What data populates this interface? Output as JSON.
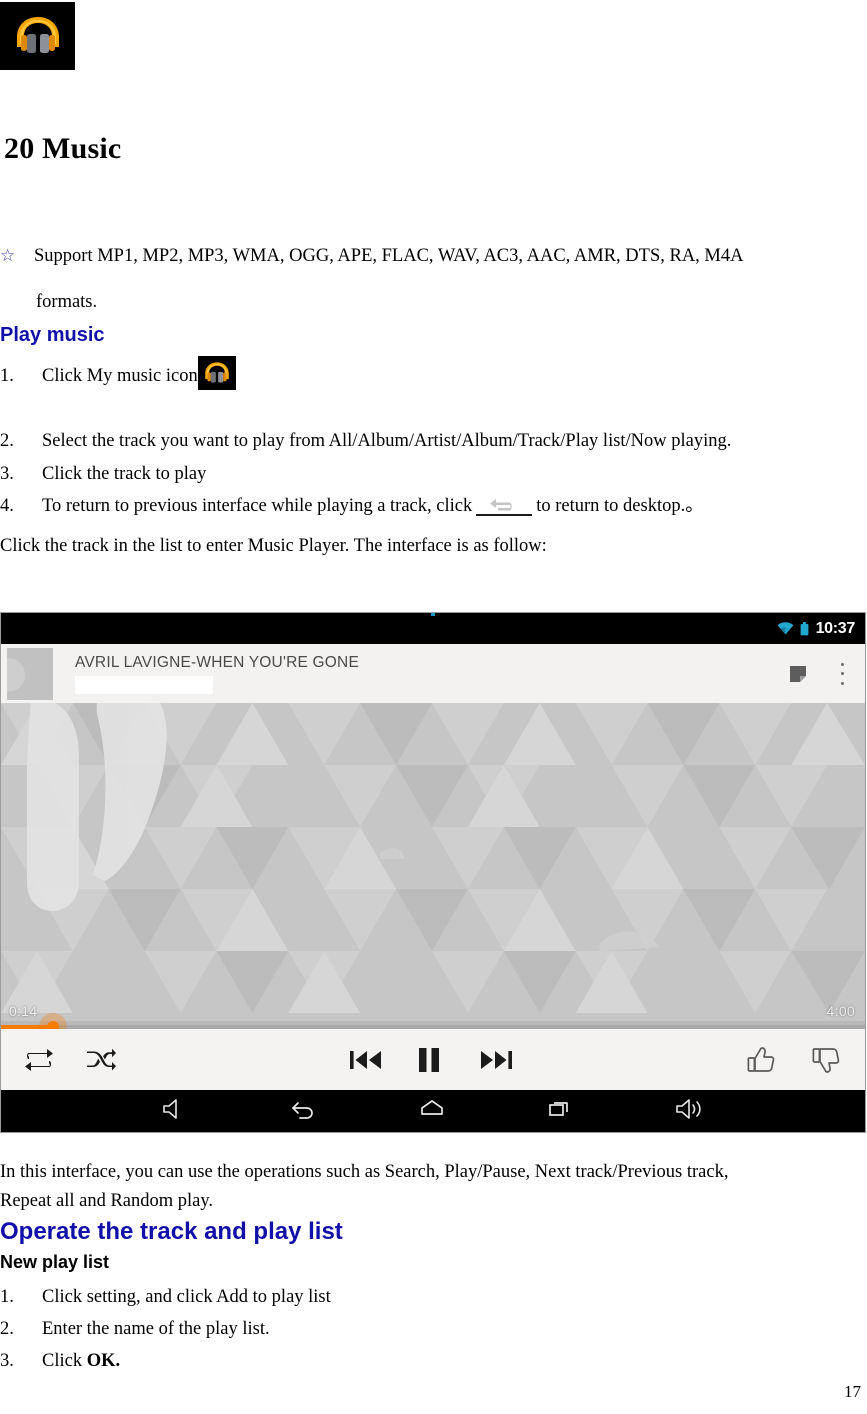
{
  "document": {
    "chapter_title": "20 Music",
    "bullet_star": "☆",
    "bullet_text": "Support MP1, MP2, MP3, WMA, OGG, APE, FLAC, WAV, AC3, AAC, AMR, DTS, RA, M4A",
    "bullet_text_cont": "formats.",
    "heading_play_music": "Play music",
    "steps_play": [
      {
        "num": "1.",
        "text_before": "Click My music icon",
        "text_after": ""
      },
      {
        "num": "2.",
        "text_before": "Select the track you want to play from All/Album/Artist/Album/Track/Play list/Now playing.",
        "text_after": ""
      },
      {
        "num": "3.",
        "text_before": "Click the track to play",
        "text_after": ""
      },
      {
        "num": "4.",
        "text_before": "To return to previous interface while playing a track, click",
        "text_after": "to return to desktop.。"
      }
    ],
    "para_enter_player": "Click the track in the list to enter Music Player. The interface is as follow:",
    "para_operations_line1": "In this interface, you can use the operations such as Search, Play/Pause, Next track/Previous track,",
    "para_operations_line2": "Repeat all and Random play.",
    "heading_operate": "Operate the track and play list",
    "heading_new_playlist": "New play list",
    "steps_playlist": [
      {
        "num": "1.",
        "text": "Click setting, and click Add to play list",
        "bold": ""
      },
      {
        "num": "2.",
        "text": "Enter the name of the play list.",
        "bold": ""
      },
      {
        "num": "3.",
        "text": "Click ",
        "bold": "OK."
      }
    ],
    "page_number": "17",
    "colors": {
      "heading_blue": "#1111aa",
      "star_blue": "#3b3bb0"
    }
  },
  "screenshot": {
    "status_bar": {
      "clock": "10:37",
      "wifi_icon": "wifi-icon",
      "battery_icon": "battery-icon",
      "icon_color": "#22a7d0"
    },
    "app_bar": {
      "track_title": "AVRIL LAVIGNE-WHEN YOU'RE GONE",
      "artist_value": "",
      "queue_icon": "queue-icon",
      "overflow_icon": "overflow-menu-icon"
    },
    "player": {
      "elapsed_time": "0:14",
      "total_time": "4:00",
      "progress_percent": 6,
      "progress_color": "#f57c00",
      "album_art_alt": "album-art"
    },
    "controls": [
      {
        "name": "repeat-button",
        "icon": "repeat-icon"
      },
      {
        "name": "shuffle-button",
        "icon": "shuffle-icon"
      },
      {
        "name": "previous-track-button",
        "icon": "previous-icon"
      },
      {
        "name": "pause-button",
        "icon": "pause-icon"
      },
      {
        "name": "next-track-button",
        "icon": "next-icon"
      },
      {
        "name": "thumbs-up-button",
        "icon": "thumbs-up-icon"
      },
      {
        "name": "thumbs-down-button",
        "icon": "thumbs-down-icon"
      }
    ],
    "nav_bar": [
      {
        "name": "volume-down-button",
        "icon": "volume-down-icon"
      },
      {
        "name": "back-button",
        "icon": "back-icon"
      },
      {
        "name": "home-button",
        "icon": "home-icon"
      },
      {
        "name": "recent-apps-button",
        "icon": "recent-apps-icon"
      },
      {
        "name": "volume-up-button",
        "icon": "volume-up-icon"
      }
    ]
  }
}
